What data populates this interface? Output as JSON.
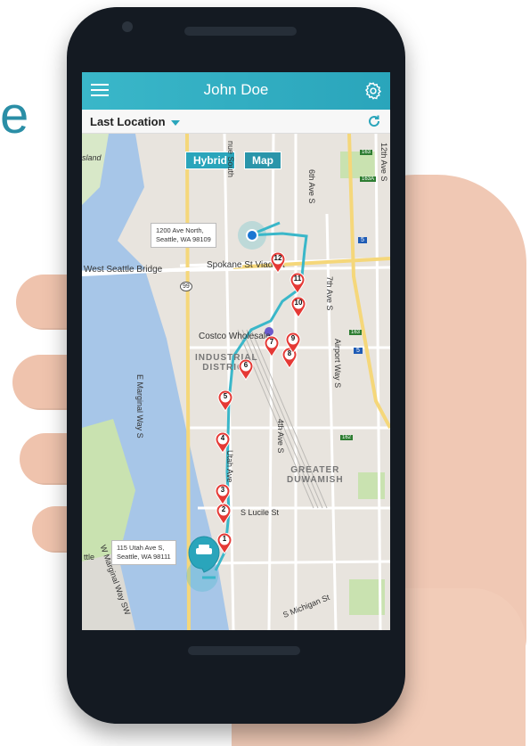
{
  "page": {
    "partial_letter": "e"
  },
  "app": {
    "title": "John Doe",
    "location_selector": "Last Location"
  },
  "map": {
    "view_toggle": {
      "hybrid_label": "Hybrid",
      "map_label": "Map"
    },
    "addresses": {
      "current": "1200 Ave North,\nSeattle, WA 98109",
      "start": "115 Utah Ave S,\nSeattle, WA 98111"
    },
    "labels": {
      "island": "sland",
      "west_seattle_bridge": "West Seattle Bridge",
      "spokane_viaduct": "Spokane St Viaduct",
      "costco": "Costco Wholesale",
      "industrial_district": "INDUSTRIAL\nDISTRICT",
      "greater_duwamish": "GREATER\nDUWAMISH",
      "s_lucile": "S Lucile St",
      "s_michigan": "S Michigan St",
      "e_marginal": "E Marginal Way S",
      "avenue_south": "nue South",
      "utah_ave": "Utah Ave",
      "airport_way": "Airport Way S",
      "sixth_ave": "6th Ave S",
      "seventh_ave": "7th Ave S",
      "fourth_ave": "4th Ave S",
      "twelfth_ave": "12th Ave S",
      "ttle": "ttle",
      "w_marginal": "W Marginal Way SW",
      "route_99": "99",
      "route_5a": "5",
      "route_5b": "5",
      "hwy_163": "163",
      "hwy_163a": "163A",
      "hwy_162": "162",
      "hwy_163b": "163"
    },
    "waypoints": [
      "1",
      "2",
      "3",
      "4",
      "5",
      "6",
      "7",
      "8",
      "9",
      "10",
      "11",
      "12"
    ]
  },
  "colors": {
    "header": "#2aa5bb",
    "route": "#3ab7c9",
    "waypoint": "#e53935",
    "map_bg": "#e8e4de",
    "water": "#a7c6e8",
    "park": "#c9e2b0"
  }
}
